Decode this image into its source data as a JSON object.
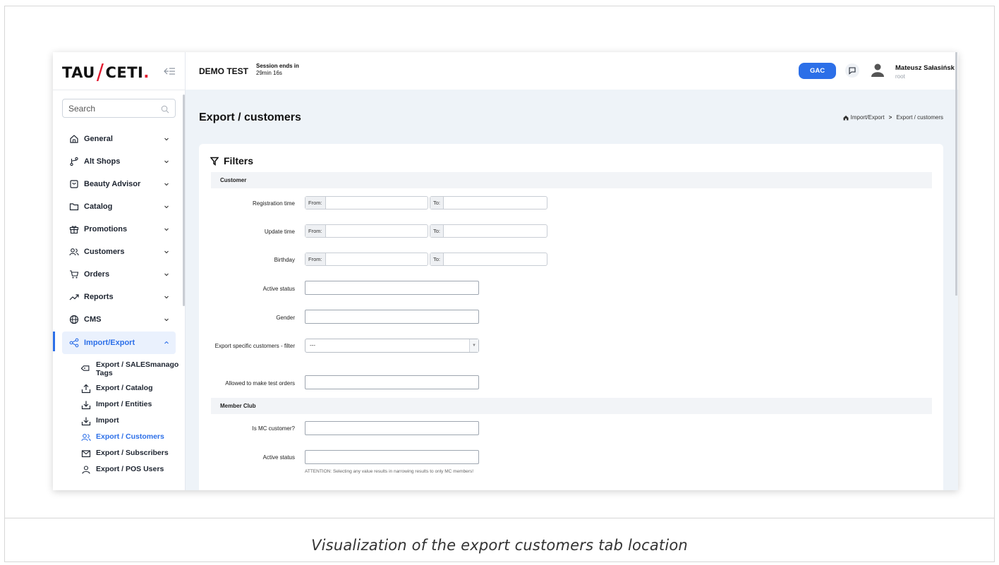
{
  "caption": "Visualization of the export customers tab location",
  "brand": {
    "part1": "TAU",
    "slash": "/",
    "part2": "CETI",
    "dot": "."
  },
  "search": {
    "placeholder": "Search"
  },
  "sidebar": {
    "items": [
      {
        "label": "General",
        "icon": "home-icon"
      },
      {
        "label": "Alt Shops",
        "icon": "branch-icon"
      },
      {
        "label": "Beauty Advisor",
        "icon": "bag-icon"
      },
      {
        "label": "Catalog",
        "icon": "folder-icon"
      },
      {
        "label": "Promotions",
        "icon": "gift-icon"
      },
      {
        "label": "Customers",
        "icon": "users-icon"
      },
      {
        "label": "Orders",
        "icon": "cart-icon"
      },
      {
        "label": "Reports",
        "icon": "trend-icon"
      },
      {
        "label": "CMS",
        "icon": "globe-icon"
      },
      {
        "label": "Import/Export",
        "icon": "share-icon"
      }
    ],
    "submenu": [
      {
        "label": "Export / SALESmanago Tags",
        "icon": "tag-icon"
      },
      {
        "label": "Export / Catalog",
        "icon": "upload-icon"
      },
      {
        "label": "Import / Entities",
        "icon": "download-icon"
      },
      {
        "label": "Import",
        "icon": "download-icon"
      },
      {
        "label": "Export / Customers",
        "icon": "users-icon"
      },
      {
        "label": "Export / Subscribers",
        "icon": "mail-icon"
      },
      {
        "label": "Export / POS Users",
        "icon": "user-icon"
      }
    ]
  },
  "topbar": {
    "env": "DEMO TEST",
    "session_label": "Session ends in",
    "session_time": "29min 16s",
    "gac": "GAC",
    "user_name": "Mateusz Sałasińsk",
    "user_role": "root"
  },
  "page": {
    "title": "Export / customers",
    "breadcrumb_root": "Import/Export",
    "breadcrumb_sep": ">",
    "breadcrumb_current": "Export / customers"
  },
  "filters": {
    "title": "Filters",
    "section_customer": "Customer",
    "registration_time": "Registration time",
    "update_time": "Update time",
    "birthday": "Birthday",
    "from": "From:",
    "to": "To:",
    "active_status": "Active status",
    "gender": "Gender",
    "export_specific": "Export specific customers - filter",
    "export_specific_value": "---",
    "allowed_test_orders": "Allowed to make test orders",
    "section_member": "Member Club",
    "is_mc_customer": "Is MC customer?",
    "mc_active_status": "Active status",
    "attention": "ATTENTION: Selecting any value results in narrowing results to only MC members!"
  }
}
